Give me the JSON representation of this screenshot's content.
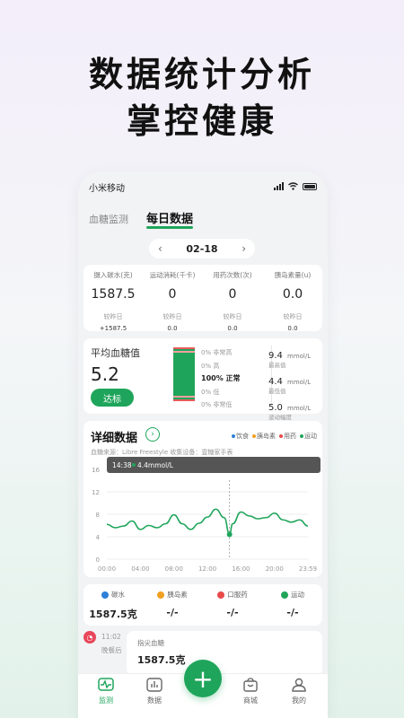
{
  "headline": {
    "line1": "数据统计分析",
    "line2": "掌控健康"
  },
  "statusbar": {
    "carrier": "小米移动"
  },
  "tabs": [
    {
      "label": "血糖监测",
      "active": false
    },
    {
      "label": "每日数据",
      "active": true
    }
  ],
  "date_nav": {
    "prev": "‹",
    "date": "02-18",
    "next": "›"
  },
  "stats": [
    {
      "label": "摄入碳水(克)",
      "value": "1587.5",
      "compare_label": "较昨日",
      "compare_value": "+1587.5"
    },
    {
      "label": "运动消耗(千卡)",
      "value": "0",
      "compare_label": "较昨日",
      "compare_value": "0.0"
    },
    {
      "label": "用药次数(次)",
      "value": "0",
      "compare_label": "较昨日",
      "compare_value": "0.0"
    },
    {
      "label": "胰岛素量(u)",
      "value": "0.0",
      "compare_label": "较昨日",
      "compare_value": "0.0"
    }
  ],
  "average": {
    "title": "平均血糖值",
    "value": "5.2",
    "button": "达标",
    "ranges": [
      {
        "text": "0% 非常高"
      },
      {
        "text": "0% 高"
      },
      {
        "text": "100% 正常"
      },
      {
        "text": "0% 低"
      },
      {
        "text": "0% 非常低"
      }
    ],
    "metrics": [
      {
        "value": "9.4",
        "unit": "mmol/L",
        "label": "最高值"
      },
      {
        "value": "4.4",
        "unit": "mmol/L",
        "label": "最低值"
      },
      {
        "value": "5.0",
        "unit": "mmol/L",
        "label": "波动幅度"
      }
    ]
  },
  "detail": {
    "title": "详细数据",
    "legend": [
      {
        "label": "饮食",
        "color": "#2f7fd8"
      },
      {
        "label": "胰岛素",
        "color": "#f0a020"
      },
      {
        "label": "用药",
        "color": "#e84a4a"
      },
      {
        "label": "运动",
        "color": "#1fa55b"
      }
    ],
    "source": "血糖来源：Libre Freestyle   收集设备：壹糖家手表",
    "tooltip": {
      "time": "14:38",
      "value": "4.4mmol/L"
    }
  },
  "chart_data": {
    "type": "line",
    "x": [
      "00:00",
      "01:00",
      "02:00",
      "03:00",
      "04:00",
      "05:00",
      "06:00",
      "07:00",
      "08:00",
      "09:00",
      "10:00",
      "11:00",
      "12:00",
      "13:00",
      "14:00",
      "14:38",
      "15:00",
      "16:00",
      "17:00",
      "18:00",
      "19:00",
      "20:00",
      "21:00",
      "22:00",
      "23:00",
      "23:59"
    ],
    "y": [
      6.2,
      5.6,
      5.9,
      6.8,
      5.3,
      6.0,
      5.6,
      6.3,
      7.9,
      6.3,
      5.3,
      6.4,
      7.5,
      8.9,
      7.4,
      4.4,
      6.3,
      8.4,
      7.7,
      7.2,
      7.4,
      8.2,
      7.0,
      6.6,
      7.0,
      5.9
    ],
    "xticks": [
      "00:00",
      "04:00",
      "08:00",
      "12:00",
      "16:00",
      "20:00",
      "23:59"
    ],
    "yticks": [
      "16",
      "12",
      "8",
      "4",
      "0"
    ],
    "ylim": [
      0,
      16
    ],
    "color": "#1fa55b"
  },
  "counts": [
    {
      "label": "碳水",
      "value": "1587.5克",
      "color": "#2f7fd8"
    },
    {
      "label": "胰岛素",
      "value": "-/-",
      "color": "#f0a020"
    },
    {
      "label": "口服药",
      "value": "-/-",
      "color": "#e84a4a"
    },
    {
      "label": "运动",
      "value": "-/-",
      "color": "#1fa55b"
    }
  ],
  "timeline": {
    "time": "11:02",
    "meal": "晚餐后",
    "kind": "指尖血糖",
    "value": "1587.5克"
  },
  "nav": [
    {
      "label": "监测",
      "active": true
    },
    {
      "label": "数据",
      "active": false
    },
    {
      "label": "商城",
      "active": false
    },
    {
      "label": "我的",
      "active": false
    }
  ]
}
